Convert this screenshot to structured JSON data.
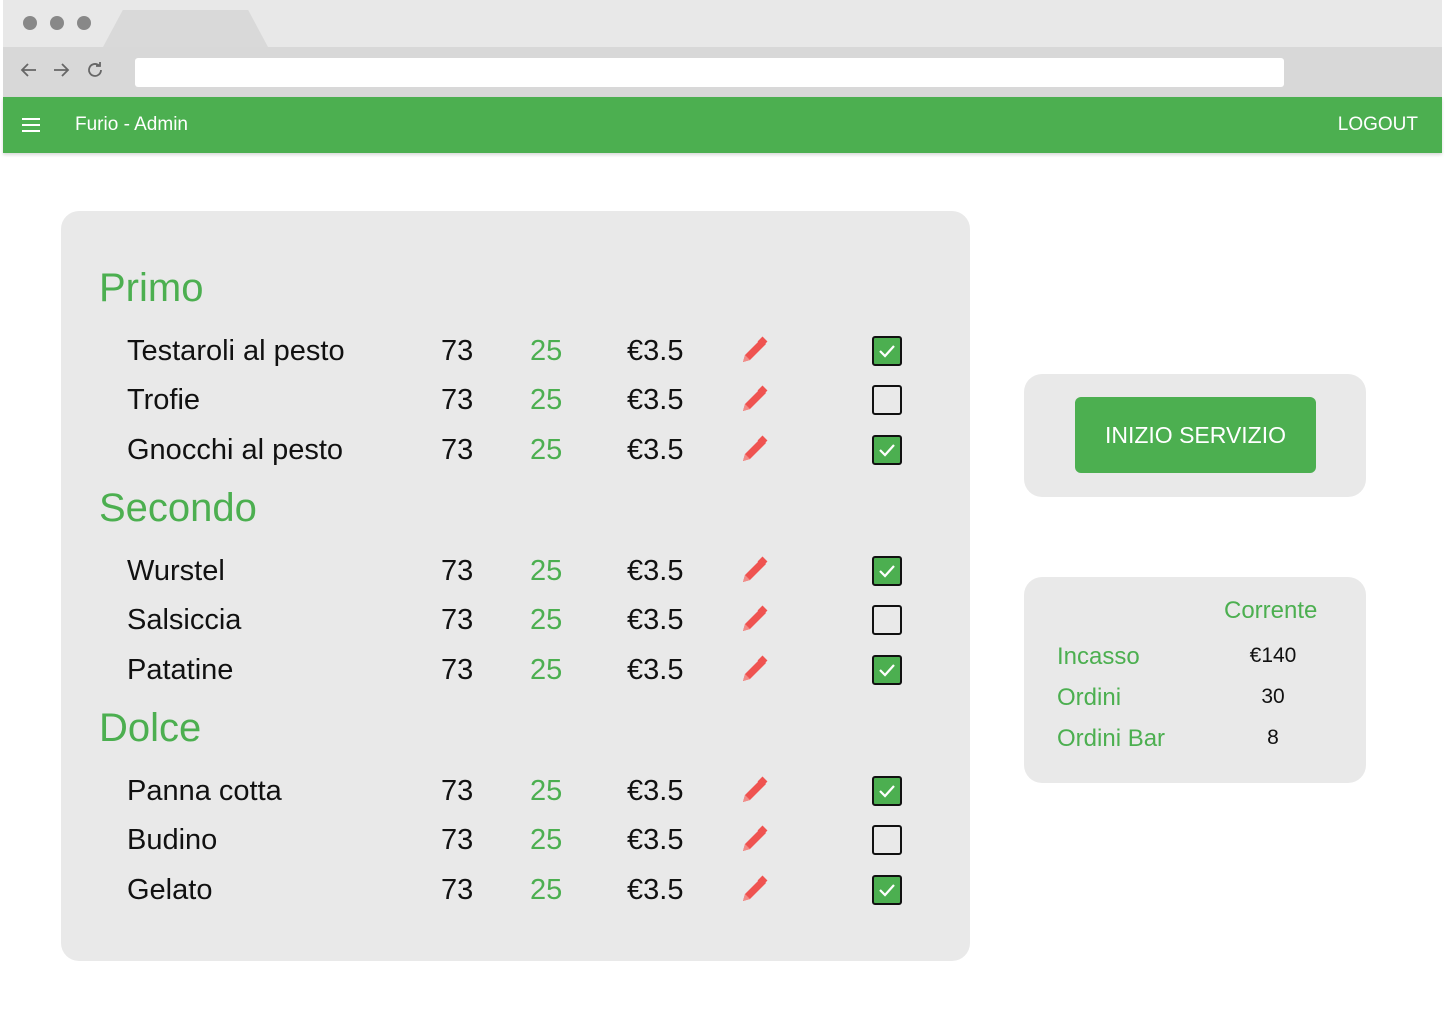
{
  "app": {
    "title": "Furio - Admin",
    "logout_label": "LOGOUT"
  },
  "colors": {
    "primary": "#4caf50",
    "edit_icon": "#ef5350",
    "card_bg": "#e9e9e9"
  },
  "browser": {
    "nav_icons": [
      "back-arrow-icon",
      "forward-arrow-icon",
      "reload-icon"
    ]
  },
  "categories": [
    {
      "title": "Primo",
      "items": [
        {
          "name": "Testaroli al pesto",
          "qty": "73",
          "green_value": "25",
          "price": "€3.5",
          "enabled": true
        },
        {
          "name": "Trofie",
          "qty": "73",
          "green_value": "25",
          "price": "€3.5",
          "enabled": false
        },
        {
          "name": "Gnocchi al pesto",
          "qty": "73",
          "green_value": "25",
          "price": "€3.5",
          "enabled": true
        }
      ]
    },
    {
      "title": "Secondo",
      "items": [
        {
          "name": "Wurstel",
          "qty": "73",
          "green_value": "25",
          "price": "€3.5",
          "enabled": true
        },
        {
          "name": "Salsiccia",
          "qty": "73",
          "green_value": "25",
          "price": "€3.5",
          "enabled": false
        },
        {
          "name": "Patatine",
          "qty": "73",
          "green_value": "25",
          "price": "€3.5",
          "enabled": true
        }
      ]
    },
    {
      "title": "Dolce",
      "items": [
        {
          "name": "Panna cotta",
          "qty": "73",
          "green_value": "25",
          "price": "€3.5",
          "enabled": true
        },
        {
          "name": "Budino",
          "qty": "73",
          "green_value": "25",
          "price": "€3.5",
          "enabled": false
        },
        {
          "name": "Gelato",
          "qty": "73",
          "green_value": "25",
          "price": "€3.5",
          "enabled": true
        }
      ]
    }
  ],
  "service": {
    "start_label": "INIZIO SERVIZIO"
  },
  "stats": {
    "column_header": "Corrente",
    "rows": [
      {
        "label": "Incasso",
        "value": "€140"
      },
      {
        "label": "Ordini",
        "value": "30"
      },
      {
        "label": "Ordini Bar",
        "value": "8"
      }
    ]
  }
}
